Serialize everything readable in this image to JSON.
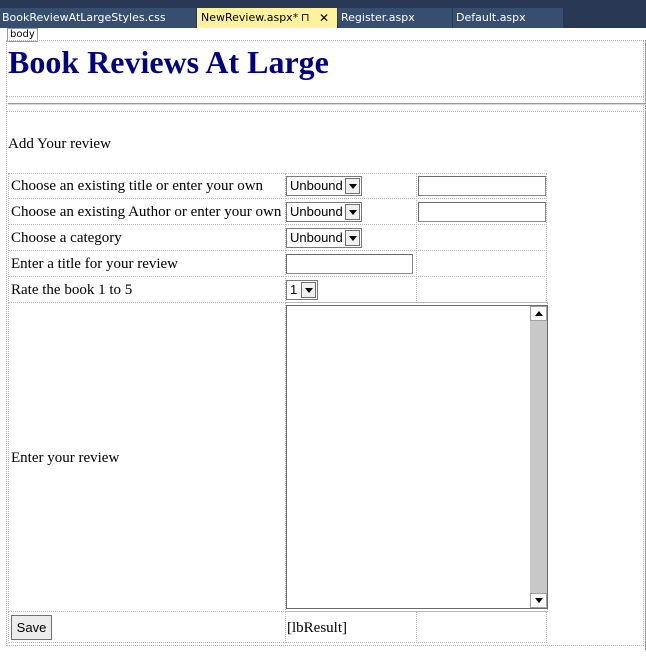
{
  "tabs": [
    {
      "label": "BookReviewAtLargeStyles.css",
      "active": false
    },
    {
      "label": "NewReview.aspx*",
      "active": true
    },
    {
      "label": "Register.aspx",
      "active": false
    },
    {
      "label": "Default.aspx",
      "active": false
    }
  ],
  "tab_pin_glyph": "⊓",
  "tab_close_glyph": "✕",
  "tag_selector": "body",
  "page": {
    "title": "Book Reviews At Large",
    "subtitle": "Add Your review"
  },
  "form": {
    "rows": [
      {
        "label": "Choose an existing title or enter your own",
        "dropdown": "Unbound"
      },
      {
        "label": "Choose an existing Author or enter your own",
        "dropdown": "Unbound"
      },
      {
        "label": "Choose a category",
        "dropdown": "Unbound"
      },
      {
        "label": "Enter a title for your review"
      },
      {
        "label": "Rate the book 1 to 5",
        "dropdown": "1"
      },
      {
        "label": "Enter your review"
      }
    ],
    "save_label": "Save",
    "result_label": "[lbResult]"
  },
  "colors": {
    "tabbar_bg": "#293955",
    "active_tab_bg": "#fff29d",
    "title_color": "#000080"
  }
}
